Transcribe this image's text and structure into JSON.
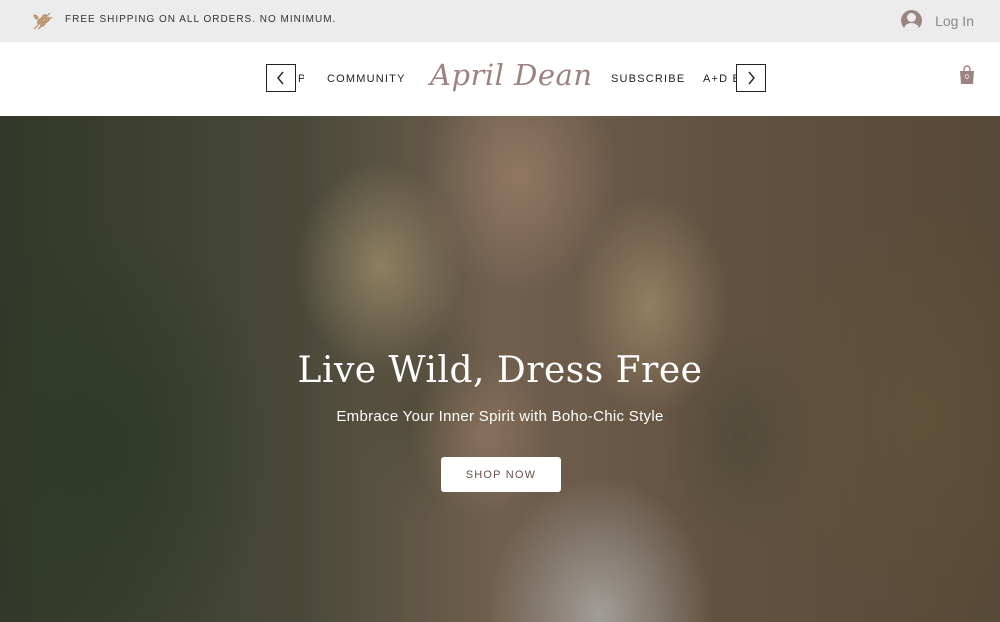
{
  "topbar": {
    "shipping_text": "FREE SHIPPING ON ALL ORDERS. NO MINIMUM.",
    "login_label": "Log In"
  },
  "nav": {
    "logo": "April Dean",
    "items": [
      "P",
      "COMMUNITY",
      "SUBSCRIBE",
      "A+D B"
    ],
    "cart_count": "0"
  },
  "hero": {
    "title": "Live Wild, Dress Free",
    "subtitle": "Embrace Your Inner Spirit with Boho-Chic Style",
    "cta_label": "SHOP NOW"
  },
  "colors": {
    "brand": "#9c8380",
    "topbar_bg": "#ececec",
    "cta_text": "#6b4f4a"
  },
  "icons": [
    "wheat-leaf-icon",
    "user-avatar-icon",
    "chevron-left-icon",
    "chevron-right-icon",
    "shopping-bag-icon"
  ]
}
